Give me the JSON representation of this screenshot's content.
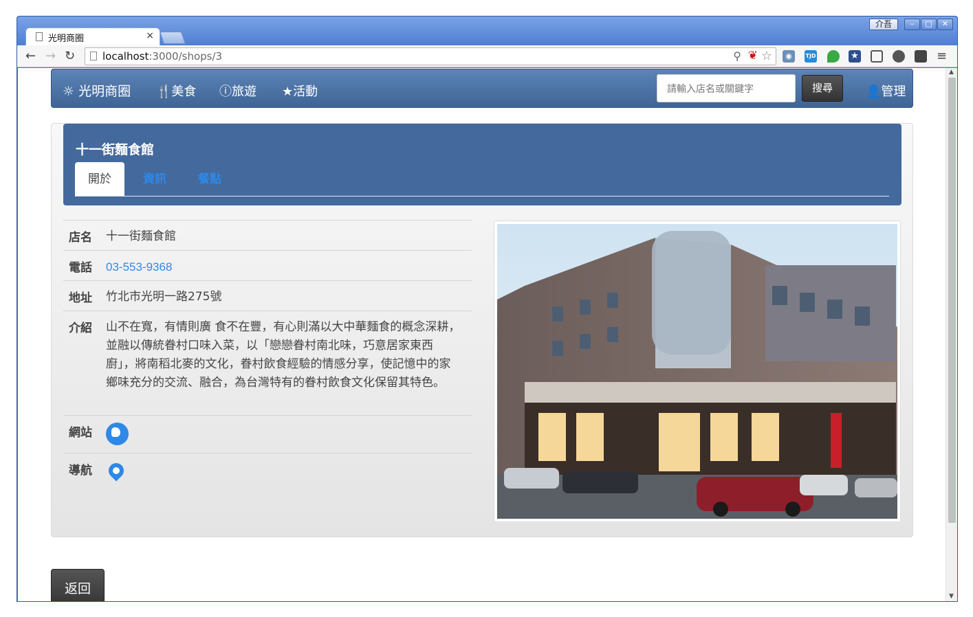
{
  "browser": {
    "tab_title": "光明商圈",
    "tab_close": "×",
    "profile_label": "介吾",
    "url_host": "localhost",
    "url_path": ":3000/shops/3",
    "ext_tjd": "TJD"
  },
  "navbar": {
    "brand": "光明商圈",
    "food": "美食",
    "travel": "旅遊",
    "event": "活動",
    "search_placeholder": "請輸入店名或關鍵字",
    "search_button": "搜尋",
    "admin": "管理"
  },
  "shop": {
    "title": "十一街麵食館",
    "tabs": [
      "開於",
      "資訊",
      "餐點"
    ],
    "rows": {
      "name_label": "店名",
      "name_value": "十一街麵食館",
      "phone_label": "電話",
      "phone_value": "03-553-9368",
      "address_label": "地址",
      "address_value": "竹北市光明一路275號",
      "intro_label": "介紹",
      "intro_value": "山不在寬，有情則廣 食不在豐，有心則滿以大中華麵食的概念深耕，並融以傳統眷村口味入菜，以「戀戀眷村南北味，巧意居家東西廚」，將南稻北麥的文化，眷村飲食經驗的情感分享，使記憶中的家鄉味充分的交流、融合，為台灣特有的眷村飲食文化保留其特色。",
      "website_label": "網站",
      "navigation_label": "導航"
    }
  },
  "back_button": "返回"
}
